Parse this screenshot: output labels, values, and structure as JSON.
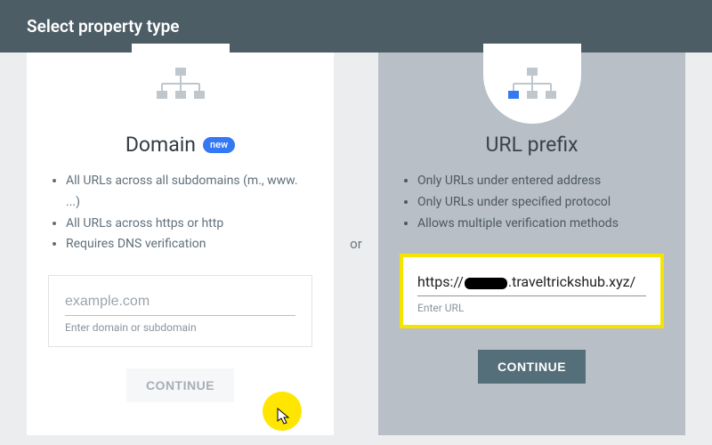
{
  "header": {
    "title": "Select property type"
  },
  "separator": "or",
  "domain_card": {
    "title": "Domain",
    "new_badge": "new",
    "bullets": [
      "All URLs across all subdomains (m., www. ...)",
      "All URLs across https or http",
      "Requires DNS verification"
    ],
    "input_placeholder": "example.com",
    "input_value": "",
    "input_help": "Enter domain or subdomain",
    "button": "CONTINUE"
  },
  "url_card": {
    "title": "URL prefix",
    "bullets": [
      "Only URLs under entered address",
      "Only URLs under specified protocol",
      "Allows multiple verification methods"
    ],
    "url_prefix": "https://",
    "url_suffix": ".traveltrickshub.xyz/",
    "input_help": "Enter URL",
    "button": "CONTINUE",
    "highlight_color": "#f5e400"
  },
  "colors": {
    "header_bg": "#4d5d66",
    "badge_bg": "#3478f6",
    "btn_primary_bg": "#546e7a",
    "cursor_highlight": "#ffe600"
  }
}
